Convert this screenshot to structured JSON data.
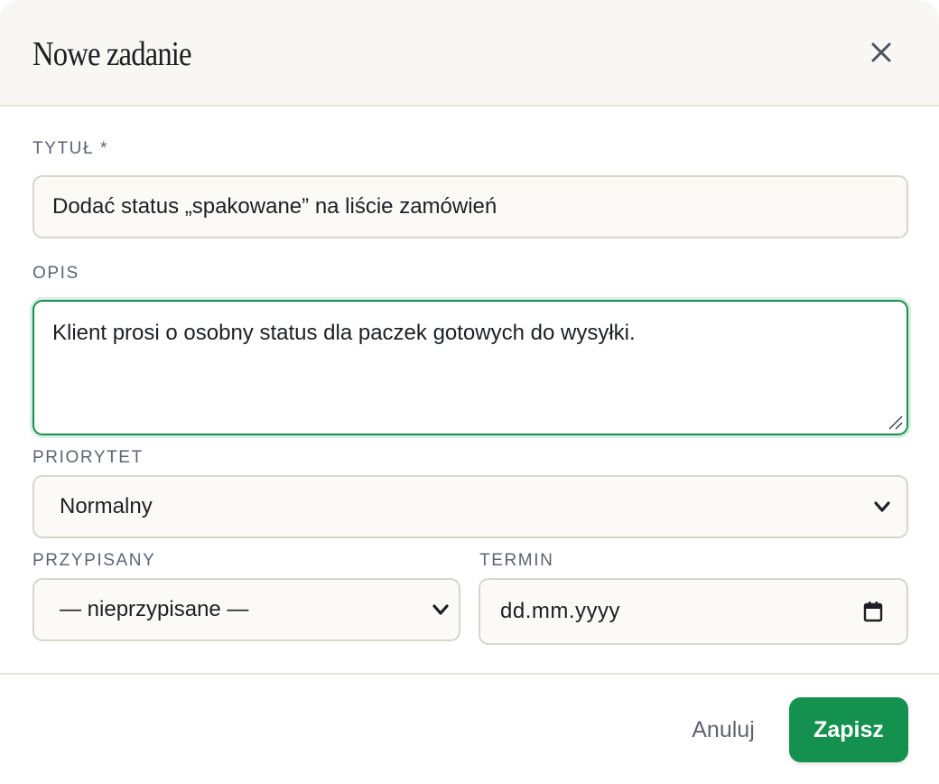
{
  "dialog": {
    "title": "Nowe zadanie"
  },
  "icons": {
    "close": "close-icon",
    "select_arrow": "chevron-down-icon",
    "date_picker": "calendar-icon",
    "resize": "resize-grip-icon"
  },
  "form": {
    "title_label": "TYTUŁ *",
    "title_value": "Dodać status „spakowane” na liście zamówień",
    "description_label": "OPIS",
    "description_value": "Klient prosi o osobny status dla paczek gotowych do wysyłki.",
    "priority_label": "PRIORYTET",
    "priority_value": "Normalny",
    "assignee_label": "PRZYPISANY",
    "assignee_value": "— nieprzypisane —",
    "due_label": "TERMIN",
    "due_placeholder": "dd.mm.yyyy"
  },
  "footer": {
    "cancel_label": "Anuluj",
    "save_label": "Zapisz"
  },
  "colors": {
    "accent": "#15914f",
    "header_bg": "#f8f7f3",
    "field_border": "#d8d5cb",
    "label_text": "#5d6470"
  }
}
